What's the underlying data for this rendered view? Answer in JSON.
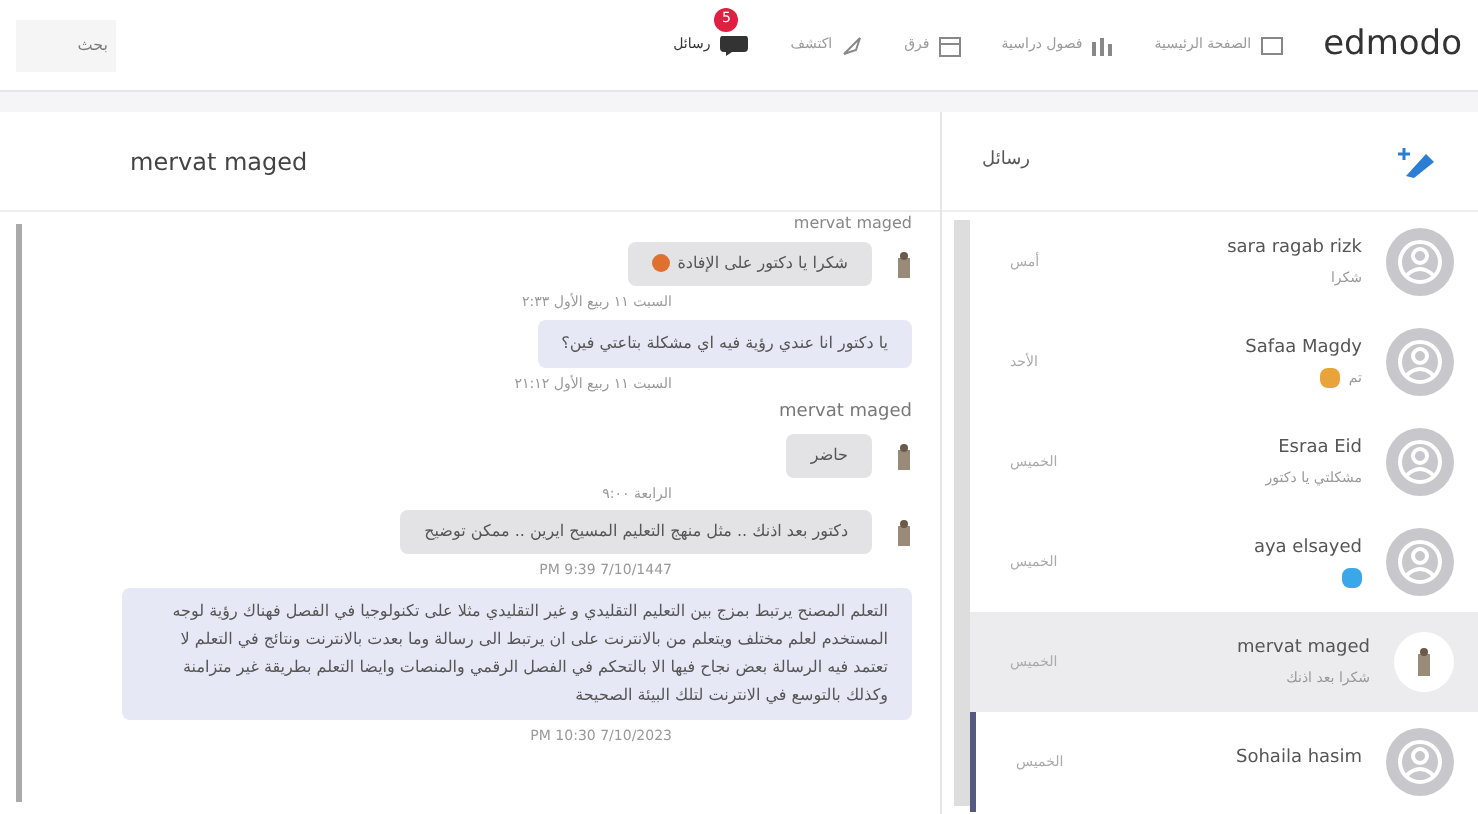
{
  "nav": {
    "logo": "edmodo",
    "items": [
      {
        "label": "الصفحة الرئيسية",
        "selected": false
      },
      {
        "label": "فصول دراسية",
        "selected": false
      },
      {
        "label": "فرق",
        "selected": false
      },
      {
        "label": "اكتشف",
        "selected": false
      },
      {
        "label": "رسائل",
        "selected": true,
        "badge": "5"
      }
    ],
    "search": {
      "placeholder": "بحث"
    }
  },
  "chat": {
    "title": "mervat maged",
    "top_sender": "mervat maged",
    "messages": [
      {
        "kind": "received",
        "text": "شكرا يا دكتور على الإفادة",
        "emoji": true,
        "time": "السبت ١١ ربيع الأول ٢:٣٣"
      },
      {
        "kind": "sent",
        "text": "يا دكتور انا عندي رؤية فيه اي مشكلة بتاعتي فين؟",
        "time": "السبت ١١ ربيع الأول ٢١:١٢"
      },
      {
        "kind": "received",
        "sender": "mervat maged",
        "text": "حاضر",
        "time": "الرابعة ٩:٠٠"
      },
      {
        "kind": "received",
        "text": "دكتور بعد اذنك .. مثل منهج التعليم المسيح ايرين .. ممكن توضيح",
        "time": "7/10/1447 9:39 PM"
      },
      {
        "kind": "sent",
        "text": "التعلم المصنح يرتبط بمزج بين التعليم التقليدي و غير التقليدي مثلا على تكنولوجيا في الفصل فهناك رؤية لوجه المستخدم لعلم مختلف ويتعلم من بالانترنت على ان يرتبط الى رسالة وما بعدت بالانترنت ونتائج في التعلم لا تعتمد فيه الرسالة بعض نجاح فيها الا بالتحكم في الفصل الرقمي والمنصات وايضا التعلم بطريقة غير متزامنة وكذلك بالتوسع في الانترنت لتلك البيئة الصحيحة",
        "time": "7/10/2023 10:30 PM"
      }
    ]
  },
  "sidebar": {
    "title": "رسائل",
    "conversations": [
      {
        "name": "sara ragab rizk",
        "preview": "شكرا",
        "time": "أمس",
        "kind": "default",
        "selected": false,
        "unread": false
      },
      {
        "name": "Safaa Magdy",
        "preview": "تم",
        "time": "الأحد",
        "kind": "default",
        "selected": false,
        "unread": false,
        "color": "#e8a33a"
      },
      {
        "name": "Esraa Eid",
        "preview": "مشكلتي يا دكتور",
        "time": "الخميس",
        "kind": "default",
        "selected": false,
        "unread": false
      },
      {
        "name": "aya elsayed",
        "time": "الخميس",
        "kind": "default",
        "selected": false,
        "unread": false,
        "color": "#3aa7e8"
      },
      {
        "name": "mervat maged",
        "preview": "شكرا بعد اذنك",
        "time": "الخميس",
        "kind": "photo",
        "selected": true,
        "unread": false
      },
      {
        "name": "Sohaila hasim",
        "time": "الخميس",
        "kind": "default",
        "selected": false,
        "unread": true
      }
    ]
  }
}
